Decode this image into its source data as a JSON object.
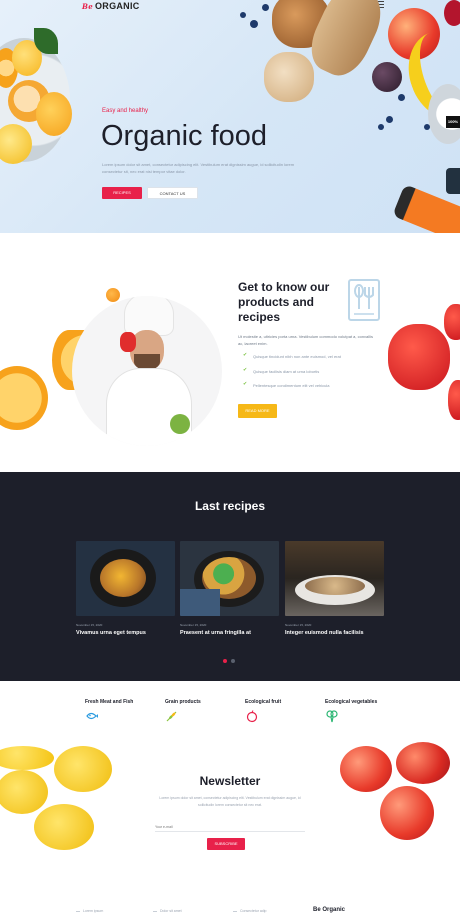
{
  "header": {
    "logo_prefix": "Be",
    "logo_text": "ORGANIC"
  },
  "hero": {
    "tagline": "Easy and healthy",
    "title": "Organic food",
    "description": "Lorem ipsum dolor sit amet, consectetur adipiscing elit. Vestibulum erat dignissim augue, id sollicitudin lorem consectetur sit, nec erat nisi tempor vitae dolor.",
    "primary_button": "RECIPES",
    "secondary_button": "CONTACT US",
    "badge": "100%"
  },
  "about": {
    "title": "Get to know our products and recipes",
    "description": "Ut molestie a, ultricies porta urna. Vestibulum commodo volutpat a, convallis ac, laoreet enim.",
    "list": [
      "Quisque tincidunt nibh non ante euismod, vel erat",
      "Quisque facilisis diam at urna lobortis",
      "Pellentesque condimentum elit vel vehicula"
    ],
    "button": "READ MORE"
  },
  "recipes": {
    "title": "Last recipes",
    "cards": [
      {
        "date": "November 15, 2020",
        "title": "Vivamus urna eget tempus"
      },
      {
        "date": "November 15, 2020",
        "title": "Praesent at urna fringilla at"
      },
      {
        "date": "November 15, 2020",
        "title": "Integer euismod nulla facilisis"
      }
    ]
  },
  "categories": [
    {
      "label": "Fresh Meat and Fish",
      "icon": "fish-icon",
      "color": "#2b9be0"
    },
    {
      "label": "Grain products",
      "icon": "wheat-icon",
      "color": "#8bc53f"
    },
    {
      "label": "Ecological fruit",
      "icon": "apple-icon",
      "color": "#e8214a"
    },
    {
      "label": "Ecological vegetables",
      "icon": "broccoli-icon",
      "color": "#2bb673"
    }
  ],
  "newsletter": {
    "title": "Newsletter",
    "description": "Lorem ipsum dolor sit amet, consectetur adipiscing elit. Vestibulum erat dignissim augue, id sollicitudin lorem consectetur sit nec erat.",
    "placeholder": "Your e-mail",
    "button": "SUBSCRIBE"
  },
  "footer": {
    "links": [
      "Lorem ipsum",
      "Dolor sit amet",
      "Consectetur adip"
    ],
    "brand": "Be Organic"
  },
  "colors": {
    "accent_red": "#e8214a",
    "accent_yellow": "#f6b817",
    "dark": "#1d1f2a",
    "green": "#7cc242"
  }
}
